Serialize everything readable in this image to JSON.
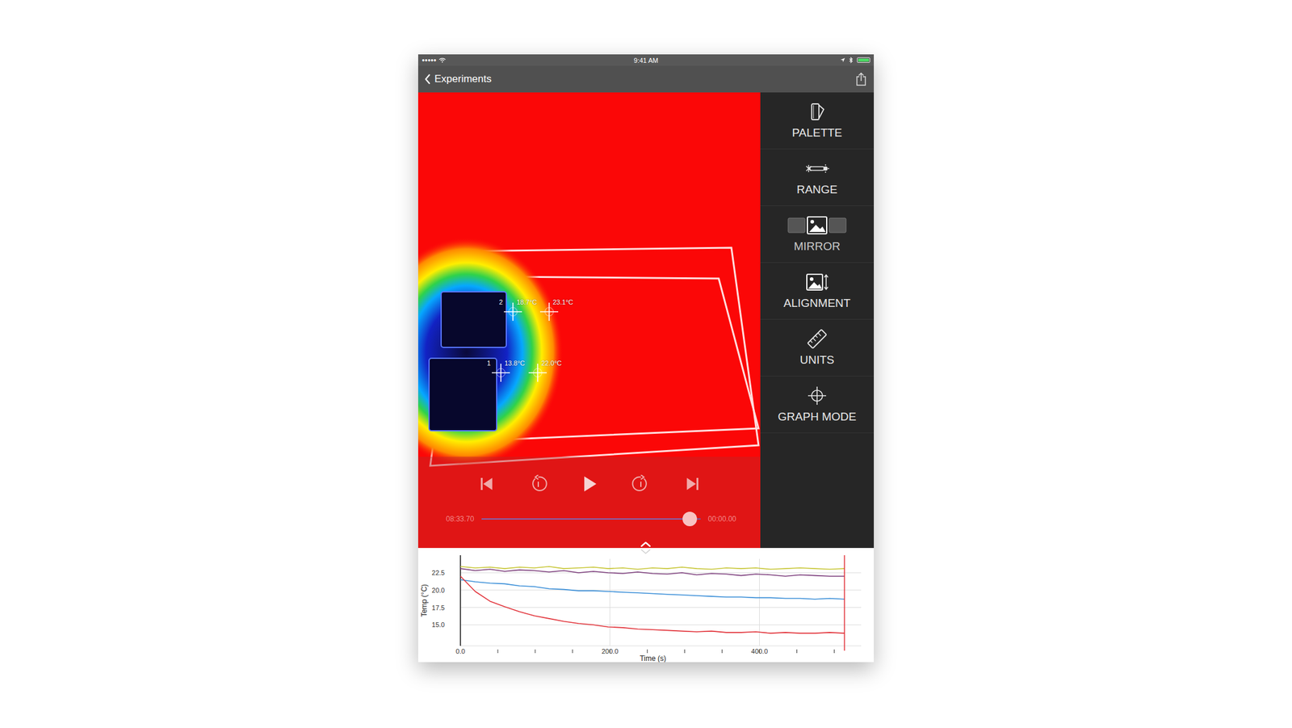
{
  "status_bar": {
    "signal": "●●●●●",
    "time": "9:41 AM"
  },
  "nav": {
    "back_label": "Experiments"
  },
  "sidebar": {
    "items": [
      {
        "label": "PALETTE"
      },
      {
        "label": "RANGE"
      },
      {
        "label": "MIRROR"
      },
      {
        "label": "ALIGNMENT"
      },
      {
        "label": "UNITS"
      },
      {
        "label": "GRAPH MODE"
      }
    ]
  },
  "markers": [
    {
      "reading": "18.7°C",
      "tag": "2"
    },
    {
      "reading": "23.1°C"
    },
    {
      "reading": "13.8°C",
      "tag": "1"
    },
    {
      "reading": "22.0°C"
    }
  ],
  "playback": {
    "elapsed": "08:33.70",
    "remaining": "00:00.00",
    "level": 0.95,
    "playing": false
  },
  "chart": {
    "y_label": "Temp (°C)",
    "x_label": "Time (s)",
    "x_min": 0,
    "x_max": 515,
    "y_min": 12.5,
    "y_max": 24.5,
    "cursor": 513.7,
    "x_ticks": [
      {
        "label": "0.0",
        "value": 0
      },
      {
        "label": "200.0",
        "value": 200
      },
      {
        "label": "400.0",
        "value": 400
      }
    ],
    "y_ticks": [
      {
        "label": "22.5",
        "value": 22.5
      },
      {
        "label": "20.0",
        "value": 20.0
      },
      {
        "label": "17.5",
        "value": 17.5
      },
      {
        "label": "15.0",
        "value": 15.0
      }
    ],
    "series": [
      {
        "color": "#c9c83c",
        "values": [
          23.4,
          23.2,
          23.3,
          23.1,
          23.3,
          23.2,
          23.4,
          23.1,
          23.2,
          23.3,
          23.1,
          23.2,
          23.0,
          23.2,
          23.1,
          23.3,
          23.1,
          23.0,
          23.2,
          23.1,
          23.2,
          23.0,
          23.1,
          23.2,
          23.1,
          23.0,
          23.1
        ]
      },
      {
        "color": "#7d3f7d",
        "values": [
          23.1,
          22.8,
          23.0,
          22.7,
          22.9,
          22.8,
          22.6,
          22.8,
          22.5,
          22.7,
          22.5,
          22.4,
          22.6,
          22.4,
          22.3,
          22.5,
          22.2,
          22.4,
          22.3,
          22.1,
          22.3,
          22.2,
          22.0,
          22.2,
          22.1,
          22.0,
          22.0
        ]
      },
      {
        "color": "#3b8fd8",
        "values": [
          21.5,
          21.2,
          21.0,
          20.9,
          20.6,
          20.5,
          20.2,
          20.1,
          19.9,
          19.9,
          19.8,
          19.7,
          19.6,
          19.5,
          19.4,
          19.3,
          19.2,
          19.1,
          19.0,
          19.0,
          18.9,
          18.9,
          18.8,
          18.8,
          18.7,
          18.8,
          18.7
        ]
      },
      {
        "color": "#e2343b",
        "values": [
          22.0,
          19.8,
          18.4,
          17.6,
          16.9,
          16.3,
          15.9,
          15.5,
          15.2,
          15.0,
          14.7,
          14.6,
          14.4,
          14.3,
          14.2,
          14.1,
          14.0,
          14.1,
          13.9,
          13.9,
          14.0,
          13.8,
          13.9,
          13.8,
          13.8,
          13.9,
          13.8
        ]
      }
    ]
  }
}
